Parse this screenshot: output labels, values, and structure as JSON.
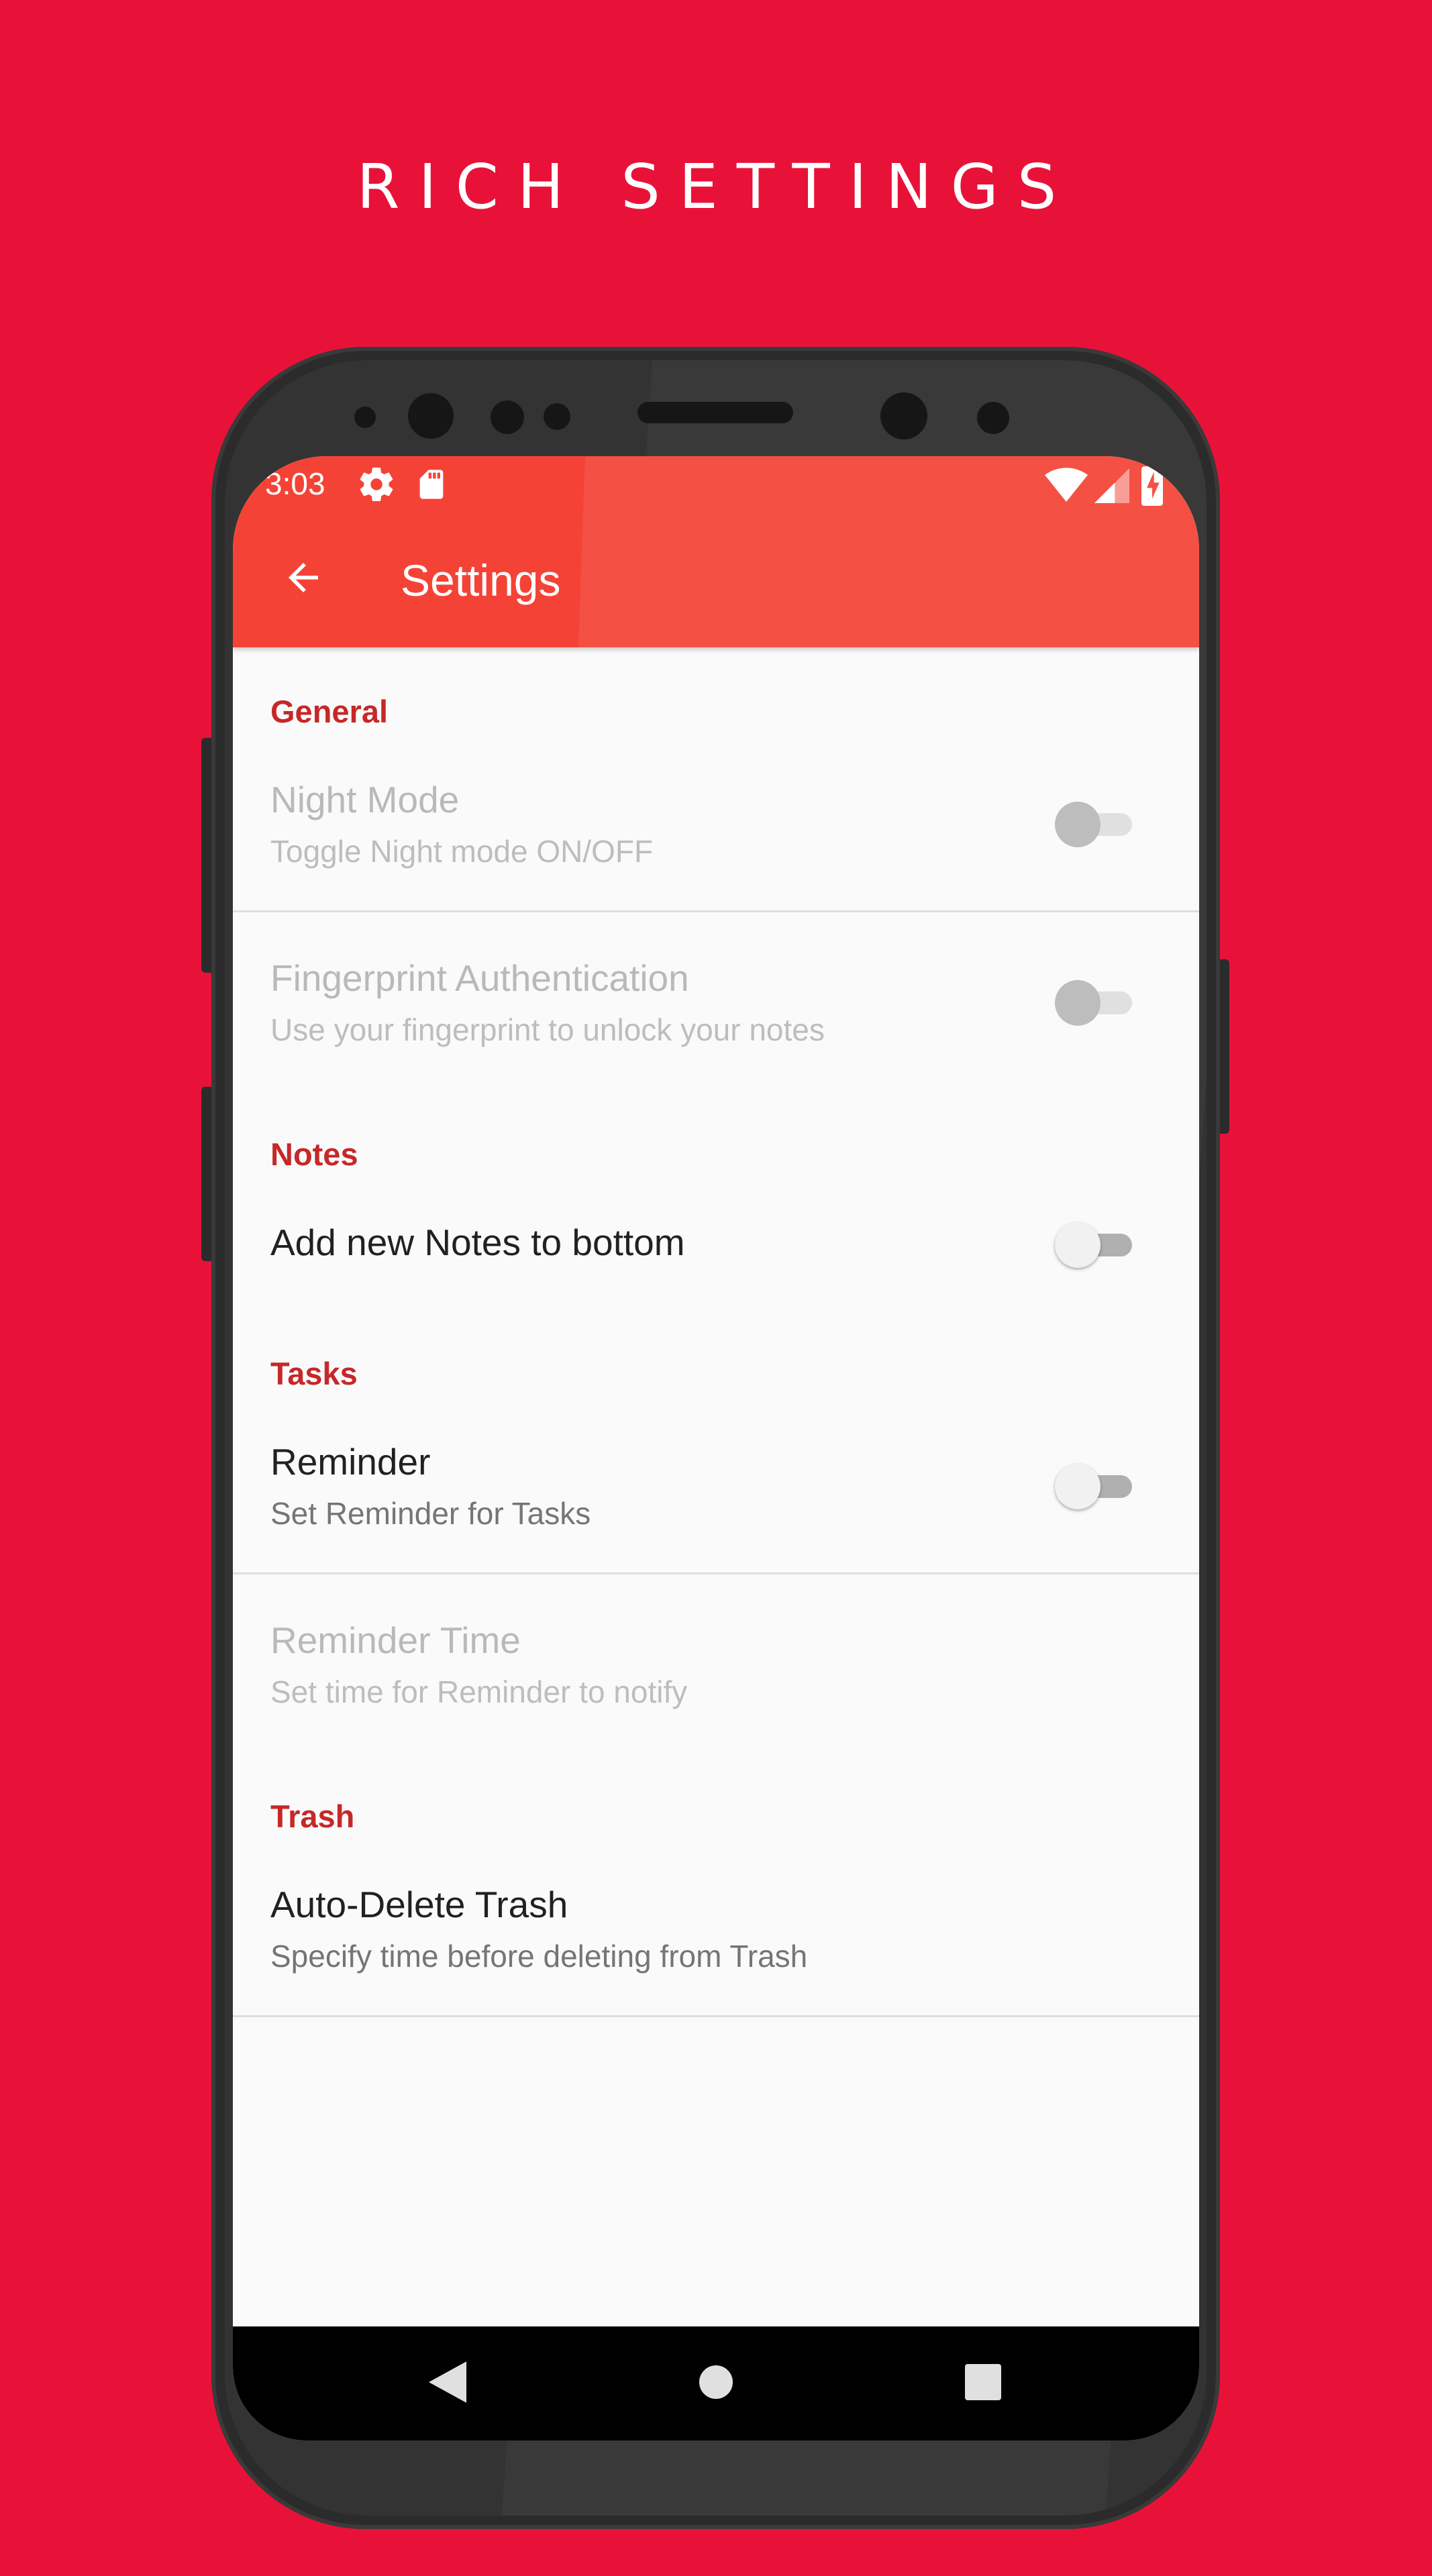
{
  "hero": {
    "title": "RICH SETTINGS"
  },
  "status_bar": {
    "time": "3:03",
    "icons": [
      "settings-icon",
      "sd-card-icon",
      "wifi-icon",
      "signal-icon",
      "battery-charging-icon"
    ]
  },
  "app_bar": {
    "back_icon": "arrow-left-icon",
    "title": "Settings"
  },
  "sections": {
    "general": {
      "title": "General",
      "night_mode": {
        "title": "Night Mode",
        "summary": "Toggle Night mode ON/OFF",
        "enabled": false,
        "checked": false
      },
      "fingerprint": {
        "title": "Fingerprint Authentication",
        "summary": "Use your fingerprint to unlock your notes",
        "enabled": false,
        "checked": false
      }
    },
    "notes": {
      "title": "Notes",
      "add_to_bottom": {
        "title": "Add new Notes to bottom",
        "enabled": true,
        "checked": false
      }
    },
    "tasks": {
      "title": "Tasks",
      "reminder": {
        "title": "Reminder",
        "summary": "Set Reminder for Tasks",
        "enabled": true,
        "checked": false
      },
      "reminder_time": {
        "title": "Reminder Time",
        "summary": "Set time for Reminder to notify",
        "enabled": false
      }
    },
    "trash": {
      "title": "Trash",
      "auto_delete": {
        "title": "Auto-Delete Trash",
        "summary": "Specify time before deleting from Trash",
        "enabled": true
      }
    }
  },
  "nav_bar": {
    "icons": [
      "back-triangle-icon",
      "home-circle-icon",
      "recents-square-icon"
    ]
  },
  "colors": {
    "background": "#e81239",
    "app_bar": "#f44336",
    "section_title": "#c62828",
    "screen": "#fafafa"
  }
}
